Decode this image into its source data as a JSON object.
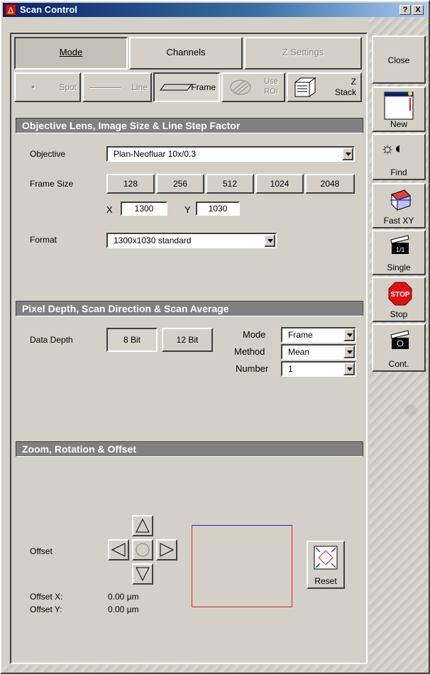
{
  "window": {
    "title": "Scan Control",
    "help_btn": "?",
    "close_btn": "X"
  },
  "tabs": {
    "mode": "Mode",
    "channels": "Channels",
    "z_settings": "Z Settings"
  },
  "modes": {
    "spot": "Spot",
    "line": "Line",
    "frame": "Frame",
    "use_roi": "Use ROI",
    "z_stack": "Z Stack"
  },
  "objective_section": {
    "header": "Objective Lens, Image Size & Line Step Factor",
    "objective_label": "Objective",
    "objective_value": "Plan-Neofluar 10x/0.3",
    "frame_size_label": "Frame Size",
    "frame_sizes": [
      "128",
      "256",
      "512",
      "1024",
      "2048"
    ],
    "x_label": "X",
    "x_value": "1300",
    "y_label": "Y",
    "y_value": "1030",
    "format_label": "Format",
    "format_value": "1300x1030 standard"
  },
  "pixel_section": {
    "header": "Pixel Depth, Scan Direction & Scan Average",
    "data_depth_label": "Data Depth",
    "bit8": "8 Bit",
    "bit12": "12 Bit",
    "mode_label": "Mode",
    "mode_value": "Frame",
    "method_label": "Method",
    "method_value": "Mean",
    "number_label": "Number",
    "number_value": "1"
  },
  "zoom_section": {
    "header": "Zoom, Rotation & Offset",
    "offset_label": "Offset",
    "offset_x_label": "Offset X:",
    "offset_x_value": "0.00 µm",
    "offset_y_label": "Offset Y:",
    "offset_y_value": "0.00 µm",
    "reset_label": "Reset"
  },
  "side_buttons": {
    "close": "Close",
    "new": "New",
    "find": "Find",
    "fast_xy": "Fast XY",
    "single": "Single",
    "stop": "Stop",
    "cont": "Cont.",
    "stop_sign": "STOP"
  }
}
